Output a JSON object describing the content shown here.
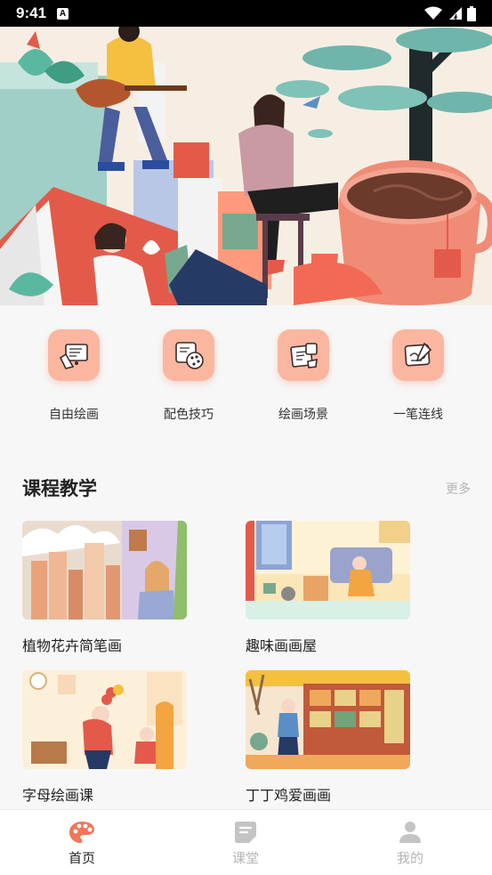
{
  "status_bar": {
    "time": "9:41",
    "badge": "A"
  },
  "categories": [
    {
      "label": "自由绘画",
      "icon": "free-draw-icon"
    },
    {
      "label": "配色技巧",
      "icon": "palette-icon"
    },
    {
      "label": "绘画场景",
      "icon": "scene-icon"
    },
    {
      "label": "一笔连线",
      "icon": "line-icon"
    }
  ],
  "section": {
    "title": "课程教学",
    "more": "更多"
  },
  "courses": [
    {
      "title": "植物花卉简笔画"
    },
    {
      "title": "趣味画画屋"
    },
    {
      "title": "字母绘画课"
    },
    {
      "title": "丁丁鸡爱画画"
    }
  ],
  "tabs": [
    {
      "label": "首页",
      "icon": "palette-icon",
      "active": true
    },
    {
      "label": "课堂",
      "icon": "note-icon",
      "active": false
    },
    {
      "label": "我的",
      "icon": "user-icon",
      "active": false
    }
  ],
  "colors": {
    "accent": "#f2765a",
    "icon_bg": "#fbb6a0",
    "muted": "#b5b5b5"
  }
}
